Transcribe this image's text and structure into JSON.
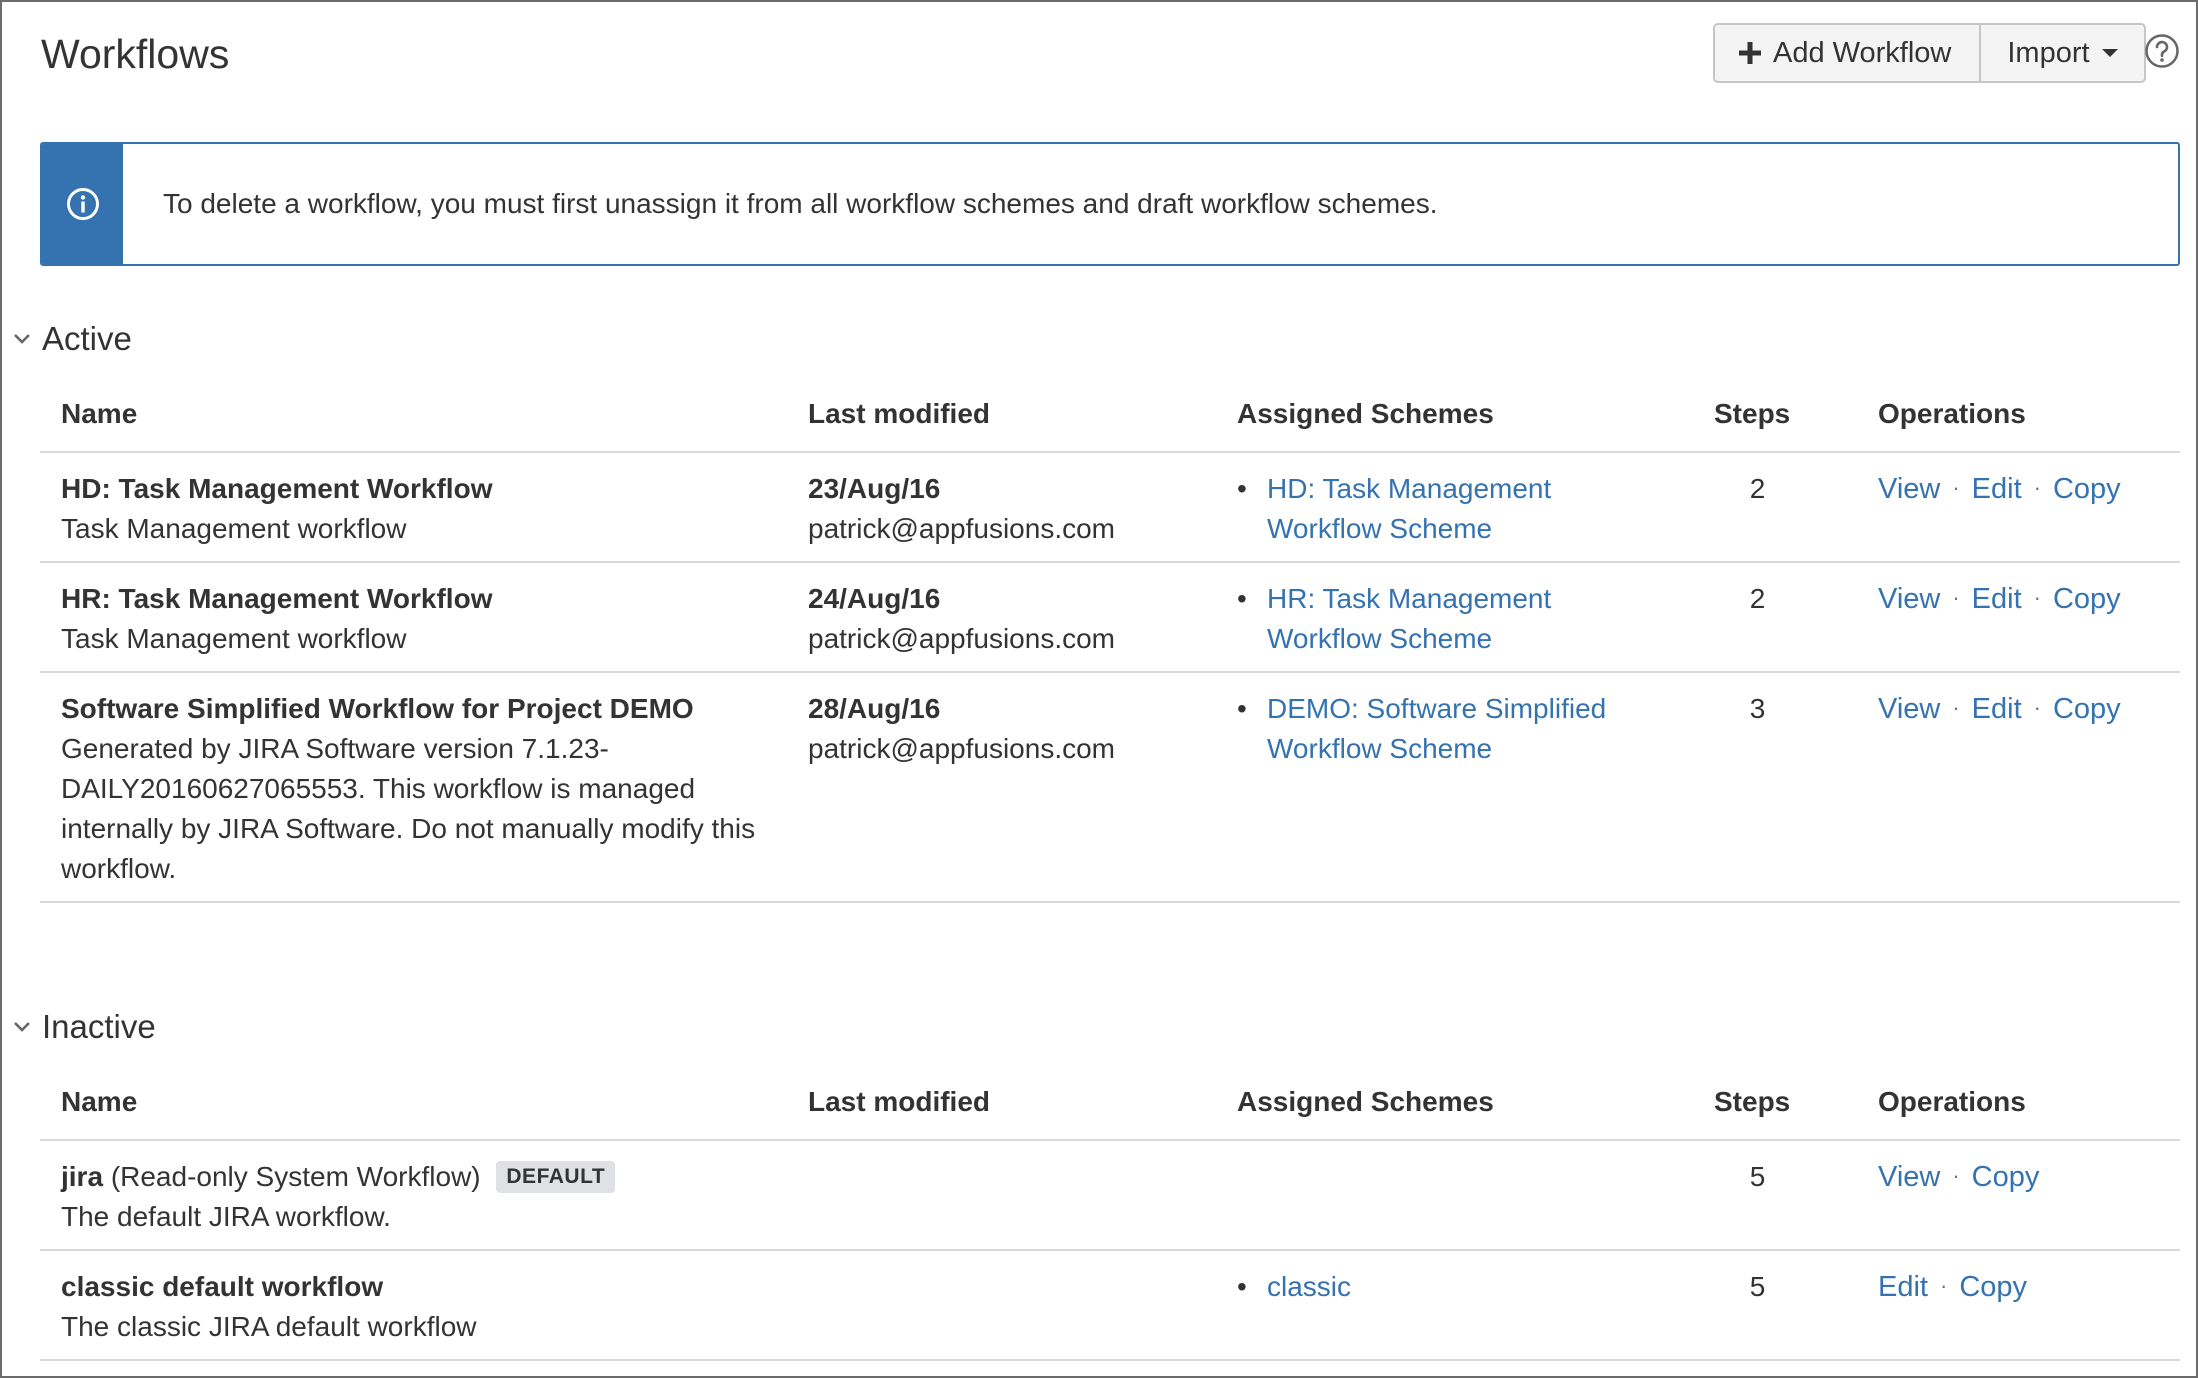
{
  "header": {
    "title": "Workflows",
    "add_workflow_label": "Add Workflow",
    "import_label": "Import"
  },
  "info_message": "To delete a workflow, you must first unassign it from all workflow schemes and draft workflow schemes.",
  "columns": {
    "name": "Name",
    "last_modified": "Last modified",
    "assigned_schemes": "Assigned Schemes",
    "steps": "Steps",
    "operations": "Operations"
  },
  "active": {
    "label": "Active",
    "rows": [
      {
        "name": "HD: Task Management Workflow",
        "description": "Task Management workflow",
        "modified_date": "23/Aug/16",
        "modified_by": "patrick@appfusions.com",
        "scheme_line1": "HD: Task Management",
        "scheme_line2": "Workflow Scheme",
        "steps": "2",
        "ops": [
          "View",
          "Edit",
          "Copy"
        ]
      },
      {
        "name": "HR: Task Management Workflow",
        "description": "Task Management workflow",
        "modified_date": "24/Aug/16",
        "modified_by": "patrick@appfusions.com",
        "scheme_line1": "HR: Task Management",
        "scheme_line2": "Workflow Scheme",
        "steps": "2",
        "ops": [
          "View",
          "Edit",
          "Copy"
        ]
      },
      {
        "name": "Software Simplified Workflow for Project DEMO",
        "description_lines": [
          "Generated by JIRA Software version 7.1.23-",
          "DAILY20160627065553. This workflow is managed",
          "internally by JIRA Software. Do not manually modify this",
          "workflow."
        ],
        "modified_date": "28/Aug/16",
        "modified_by": "patrick@appfusions.com",
        "scheme_line1": "DEMO: Software Simplified",
        "scheme_line2": "Workflow Scheme",
        "steps": "3",
        "ops": [
          "View",
          "Edit",
          "Copy"
        ]
      }
    ]
  },
  "inactive": {
    "label": "Inactive",
    "rows": [
      {
        "name": "jira",
        "name_suffix": "(Read-only System Workflow)",
        "badge": "DEFAULT",
        "description": "The default JIRA workflow.",
        "steps": "5",
        "ops": [
          "View",
          "Copy"
        ]
      },
      {
        "name": "classic default workflow",
        "description": "The classic JIRA default workflow",
        "scheme": "classic",
        "steps": "5",
        "ops": [
          "Edit",
          "Copy"
        ]
      }
    ]
  }
}
